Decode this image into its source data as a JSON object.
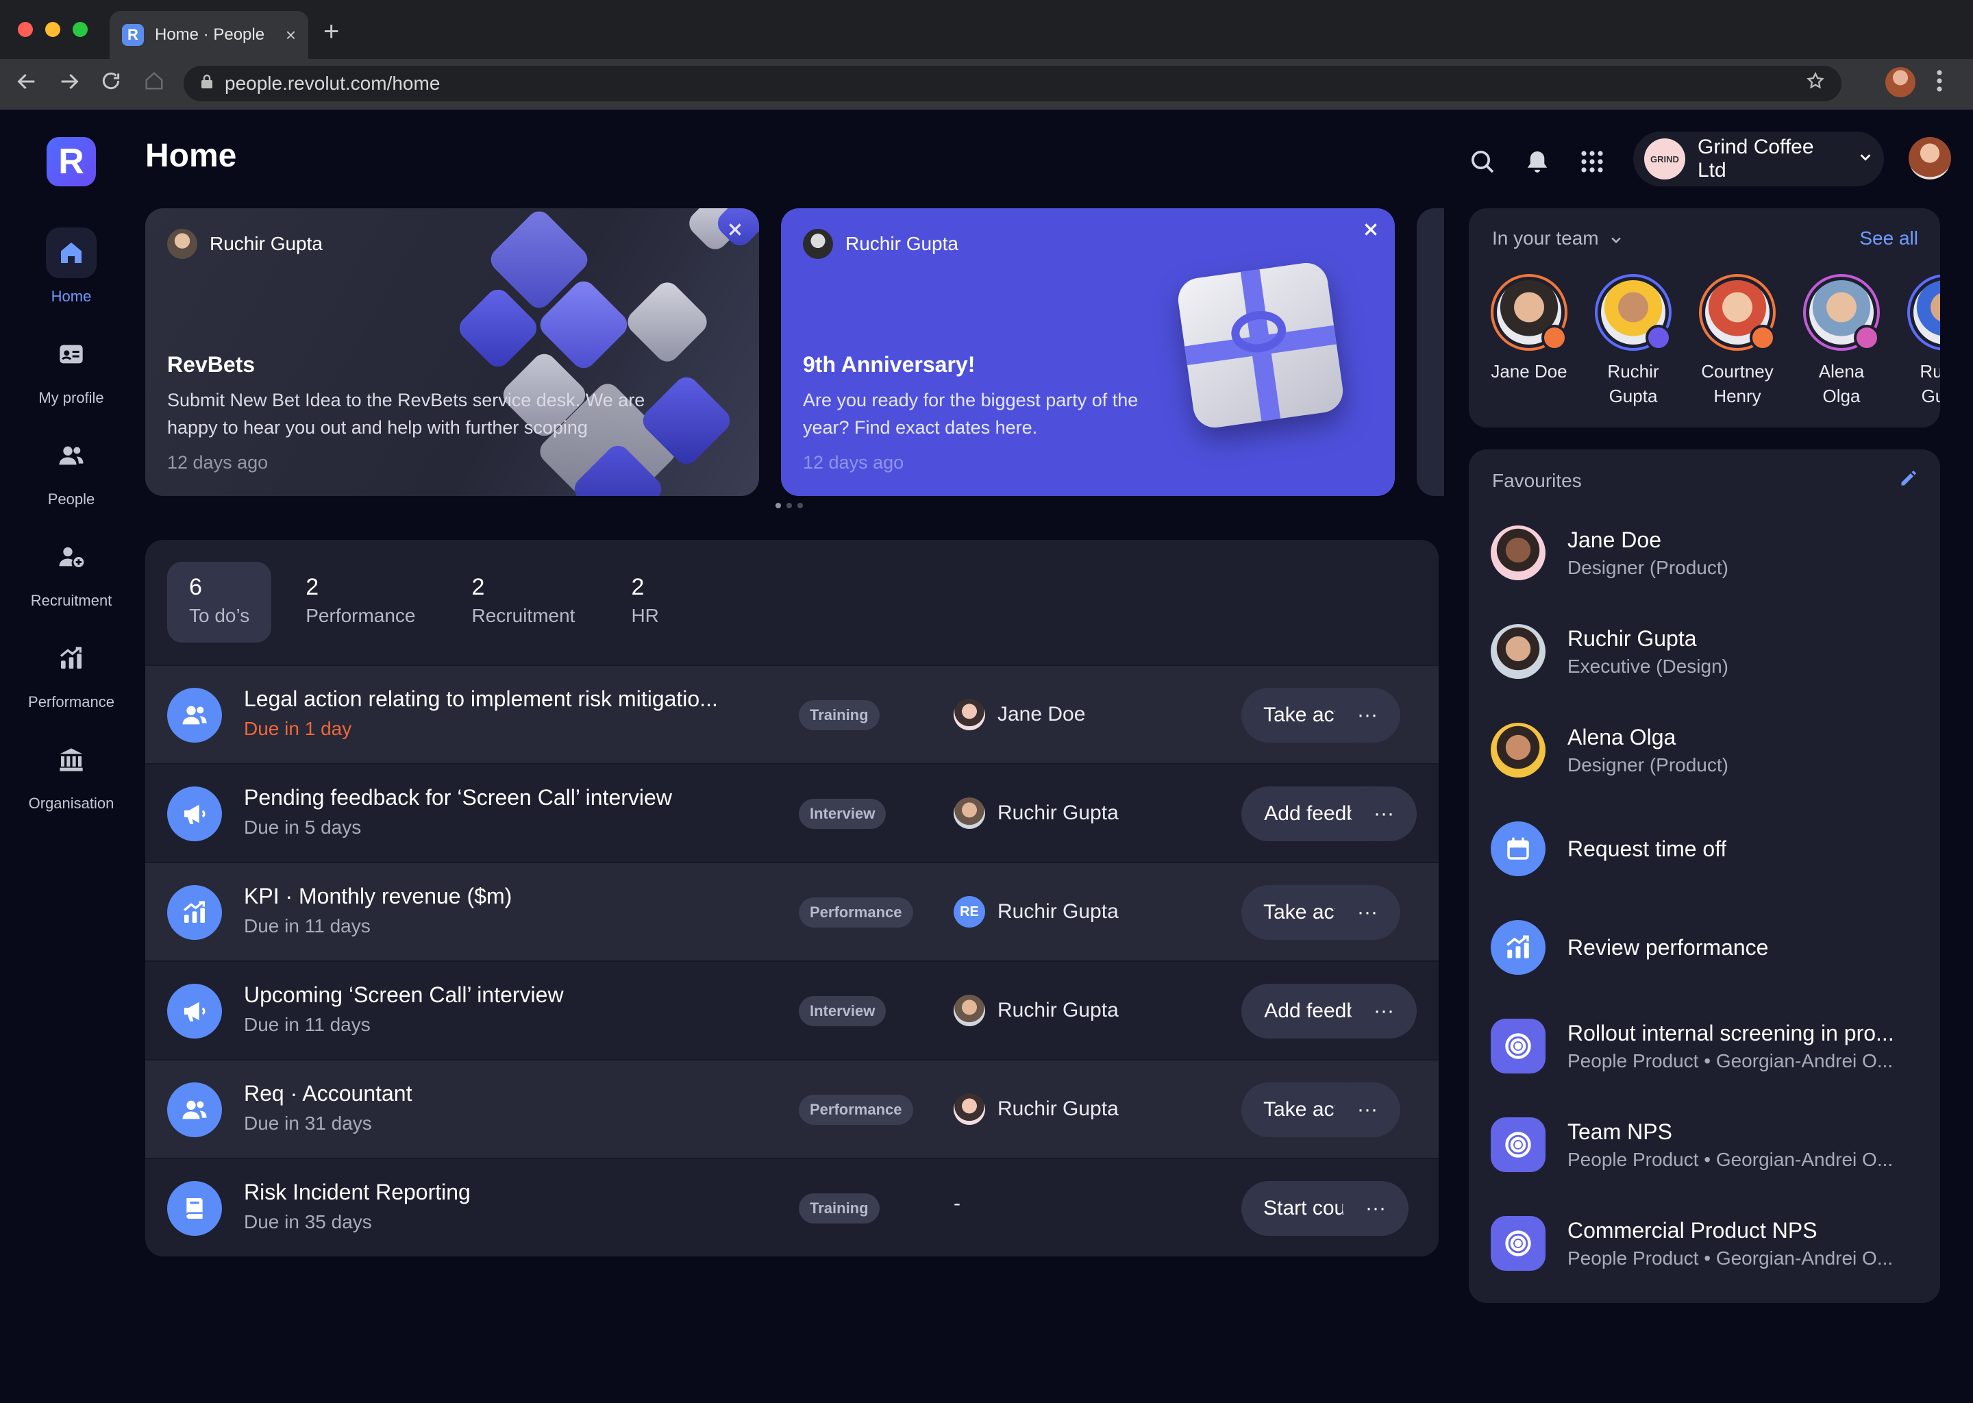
{
  "browser": {
    "tab_title": "Home · People",
    "favicon_letter": "R",
    "close_glyph": "×",
    "new_tab_glyph": "+",
    "url": "people.revolut.com/home",
    "icons": [
      "back-icon",
      "forward-icon",
      "reload-icon",
      "home-icon",
      "lock-icon",
      "star-icon",
      "menu-icon"
    ]
  },
  "app": {
    "logo_letter": "R",
    "page_title": "Home",
    "company": {
      "logo_text": "GRIND",
      "name": "Grind Coffee Ltd"
    }
  },
  "sidebar": {
    "items": [
      {
        "label": "Home",
        "icon": "home-icon",
        "active": true
      },
      {
        "label": "My profile",
        "icon": "id-card-icon"
      },
      {
        "label": "People",
        "icon": "people-icon"
      },
      {
        "label": "Recruitment",
        "icon": "add-person-icon"
      },
      {
        "label": "Performance",
        "icon": "chart-up-icon"
      },
      {
        "label": "Organisation",
        "icon": "bank-icon"
      }
    ]
  },
  "announcements": [
    {
      "author": "Ruchir Gupta",
      "title": "RevBets",
      "description": "Submit New Bet Idea to the RevBets service desk. We are happy to hear you out and help with further scoping",
      "time": "12 days ago"
    },
    {
      "author": "Ruchir Gupta",
      "title": "9th Anniversary!",
      "description": "Are you ready for the biggest party of the year? Find exact dates here.",
      "time": "12 days ago"
    }
  ],
  "todo_tabs": [
    {
      "count": "6",
      "label": "To do’s",
      "active": true
    },
    {
      "count": "2",
      "label": "Performance"
    },
    {
      "count": "2",
      "label": "Recruitment"
    },
    {
      "count": "2",
      "label": "HR"
    }
  ],
  "todos": [
    {
      "icon": "people-icon",
      "title": "Legal action relating to implement risk mitigatio...",
      "due": "Due in 1 day",
      "overdue": true,
      "tag": "Training",
      "person": "Jane Doe",
      "avatar": "f",
      "action": "Take action",
      "more": "···"
    },
    {
      "icon": "megaphone-icon",
      "title": "Pending feedback for ‘Screen Call’ interview",
      "due": "Due in 5 days",
      "tag": "Interview",
      "person": "Ruchir Gupta",
      "avatar": "m",
      "action": "Add feedback",
      "more": "···"
    },
    {
      "icon": "chart-up-icon",
      "title": "KPI · Monthly revenue ($m)",
      "due": "Due in 11 days",
      "tag": "Performance",
      "person": "Ruchir Gupta",
      "avatar": "re",
      "avatar_text": "RE",
      "action": "Take action",
      "more": "···"
    },
    {
      "icon": "megaphone-icon",
      "title": "Upcoming ‘Screen Call’ interview",
      "due": "Due in 11 days",
      "tag": "Interview",
      "person": "Ruchir Gupta",
      "avatar": "m",
      "action": "Add feedback",
      "more": "···"
    },
    {
      "icon": "people-icon",
      "title": "Req · Accountant",
      "due": "Due in 31 days",
      "tag": "Performance",
      "person": "Ruchir Gupta",
      "avatar": "f",
      "action": "Take action",
      "more": "···"
    },
    {
      "icon": "book-icon",
      "title": "Risk Incident Reporting",
      "due": "Due in 35 days",
      "tag": "Training",
      "person": "-",
      "avatar": "none",
      "action": "Start course",
      "more": "···"
    }
  ],
  "team": {
    "heading": "In your team",
    "see_all": "See all",
    "members": [
      {
        "name": "Jane Doe",
        "ring": "#f0763c",
        "badge": "#f0763c",
        "skin": "#e7b898",
        "hair": "#2f2a28"
      },
      {
        "name": "Ruchir Gupta",
        "ring": "#5b6cff",
        "badge": "#6a58e8",
        "skin": "#c98f66",
        "hair": "#f6c233"
      },
      {
        "name": "Courtney Henry",
        "ring": "#f0763c",
        "badge": "#f0763c",
        "skin": "#f0c8a8",
        "hair": "#d4503a"
      },
      {
        "name": "Alena Olga",
        "ring": "#c25bd8",
        "badge": "#d45bb8",
        "skin": "#e8c0a0",
        "hair": "#7d9fc4"
      },
      {
        "name": "Ruchir Gupta",
        "ring": "#5b6cff",
        "badge": "#6a58e8",
        "skin": "#d8a884",
        "hair": "#3b6ad8"
      }
    ]
  },
  "favourites": {
    "heading": "Favourites",
    "items": [
      {
        "title": "Jane Doe",
        "subtitle": "Designer (Product)",
        "type": "person",
        "bg": "#f6d0d8",
        "skin": "#8a5a44"
      },
      {
        "title": "Ruchir Gupta",
        "subtitle": "Executive (Design)",
        "type": "person",
        "bg": "#cdd6df",
        "skin": "#d8ac8c"
      },
      {
        "title": "Alena Olga",
        "subtitle": "Designer (Product)",
        "type": "person",
        "bg": "#f3c240",
        "skin": "#c88d68"
      },
      {
        "title": "Request time off",
        "subtitle": "",
        "type": "calendar-icon"
      },
      {
        "title": "Review performance",
        "subtitle": "",
        "type": "chart-up-icon"
      },
      {
        "title": "Rollout internal screening in pro...",
        "subtitle": "People Product • Georgian-Andrei O...",
        "type": "target-icon"
      },
      {
        "title": "Team NPS",
        "subtitle": "People Product • Georgian-Andrei O...",
        "type": "target-icon"
      },
      {
        "title": "Commercial Product NPS",
        "subtitle": "People Product • Georgian-Andrei O...",
        "type": "target-icon"
      }
    ]
  }
}
